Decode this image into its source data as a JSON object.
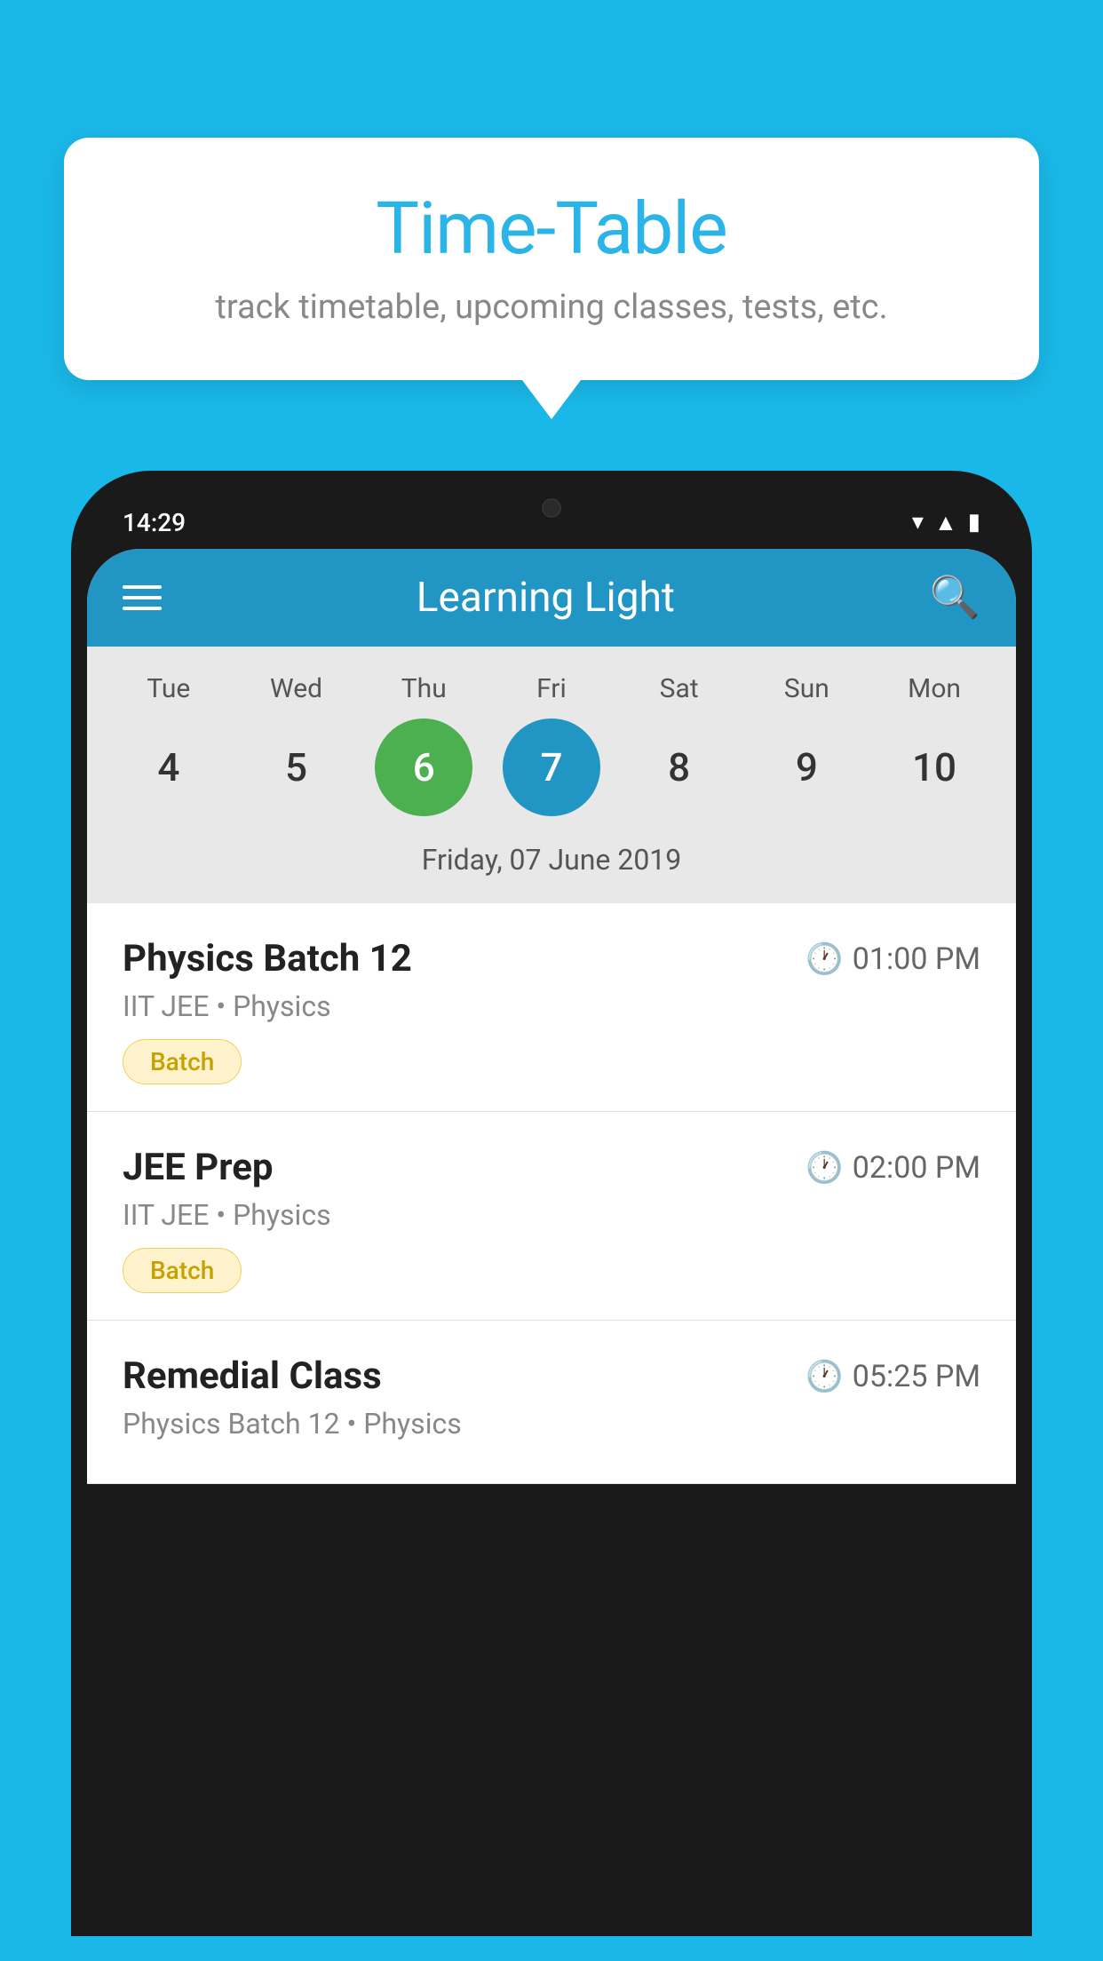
{
  "background_color": "#1ab8e8",
  "bubble": {
    "title": "Time-Table",
    "subtitle": "track timetable, upcoming classes, tests, etc."
  },
  "status_bar": {
    "time": "14:29"
  },
  "app_bar": {
    "title": "Learning Light"
  },
  "calendar": {
    "days": [
      "Tue",
      "Wed",
      "Thu",
      "Fri",
      "Sat",
      "Sun",
      "Mon"
    ],
    "dates": [
      4,
      5,
      6,
      7,
      8,
      9,
      10
    ],
    "today_index": 2,
    "selected_index": 3,
    "selected_label": "Friday, 07 June 2019"
  },
  "schedule": [
    {
      "title": "Physics Batch 12",
      "time": "01:00 PM",
      "subtitle": "IIT JEE • Physics",
      "tag": "Batch"
    },
    {
      "title": "JEE Prep",
      "time": "02:00 PM",
      "subtitle": "IIT JEE • Physics",
      "tag": "Batch"
    },
    {
      "title": "Remedial Class",
      "time": "05:25 PM",
      "subtitle": "Physics Batch 12 • Physics",
      "tag": ""
    }
  ]
}
